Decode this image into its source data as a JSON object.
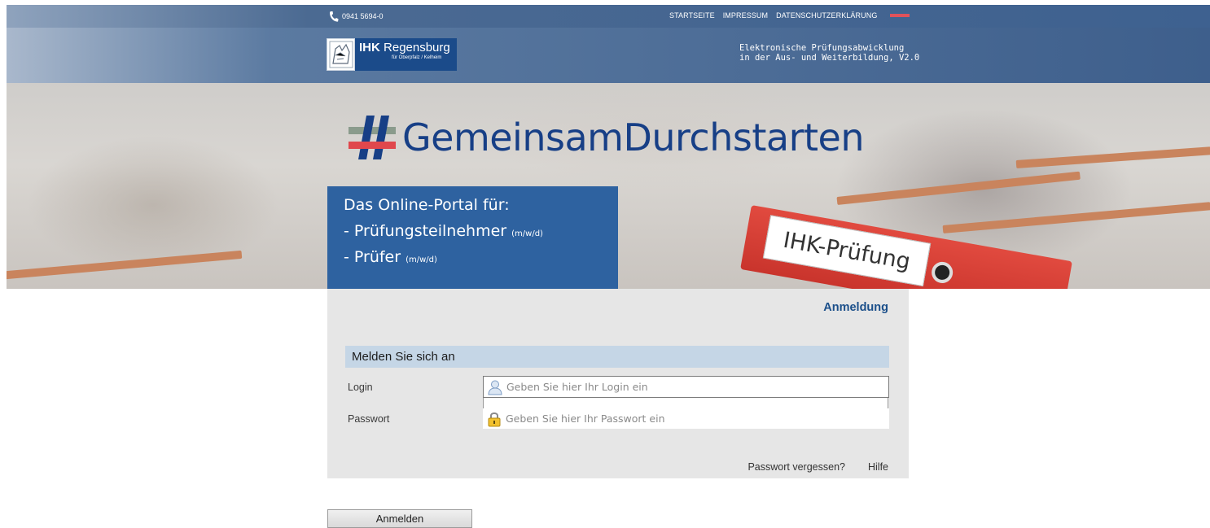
{
  "topbar": {
    "phone": "0941 5694-0",
    "nav": [
      "STARTSEITE",
      "IMPRESSUM",
      "DATENSCHUTZERKLÄRUNG"
    ]
  },
  "header": {
    "logo_ihk": "IHK",
    "logo_city": "Regensburg",
    "logo_sub": "für Oberpfalz / Kelheim",
    "tagline_line1": "Elektronische Prüfungsabwicklung",
    "tagline_line2": "in der Aus- und Weiterbildung, V2.0"
  },
  "hero": {
    "headline": "GemeinsamDurchstarten",
    "portal_line1": "Das Online-Portal für:",
    "portal_line2": "- Prüfungsteilnehmer",
    "portal_line2_small": "(m/w/d)",
    "portal_line3": "- Prüfer",
    "portal_line3_small": "(m/w/d)",
    "folder_label": "IHK-Prüfung"
  },
  "login": {
    "panel_title": "Anmeldung",
    "section_title": "Melden Sie sich an",
    "login_label": "Login",
    "login_placeholder": "Geben Sie hier Ihr Login ein",
    "password_label": "Passwort",
    "password_placeholder": "Geben Sie hier Ihr Passwort ein",
    "forgot_link": "Passwort vergessen?",
    "help_link": "Hilfe",
    "submit_label": "Anmelden"
  },
  "colors": {
    "accent_blue": "#1b4f8a",
    "hero_box": "#2e62a0",
    "red_accent": "#e0525b"
  }
}
